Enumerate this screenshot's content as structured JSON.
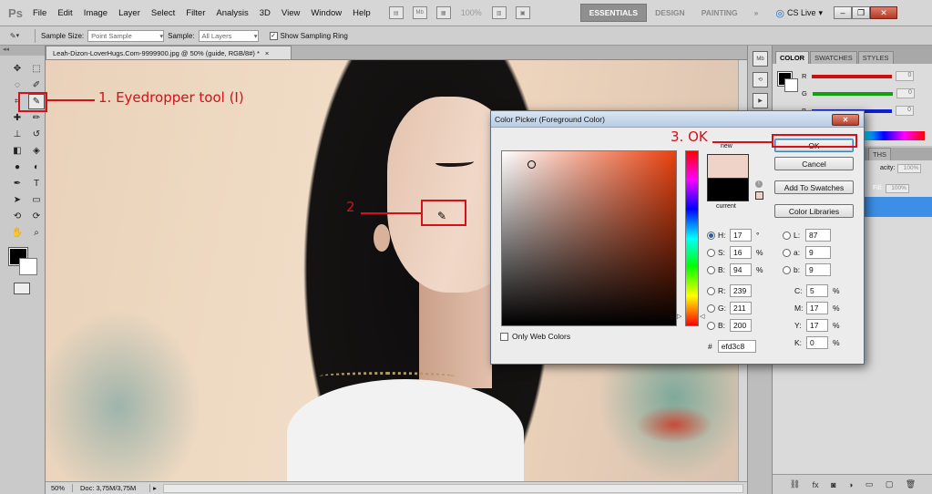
{
  "app": {
    "logo": "Ps",
    "menu": [
      "File",
      "Edit",
      "Image",
      "Layer",
      "Select",
      "Filter",
      "Analysis",
      "3D",
      "View",
      "Window",
      "Help"
    ],
    "mb_icon": "Mb",
    "zoom_dropdown": "100%",
    "workspaces": [
      "ESSENTIALS",
      "DESIGN",
      "PAINTING"
    ],
    "workspace_more": "»",
    "cs_live": "CS Live"
  },
  "options_bar": {
    "sample_size_label": "Sample Size:",
    "sample_size_value": "Point Sample",
    "sample_label": "Sample:",
    "sample_value": "All Layers",
    "show_ring_label": "Show Sampling Ring",
    "show_ring_checked": true
  },
  "document": {
    "tab_title": "Leah-Dizon-LoverHugs.Com-9999900.jpg @ 50% (guide, RGB/8#) *",
    "tab_close": "×",
    "zoom": "50%",
    "doc_size": "Doc: 3,75M/3,75M"
  },
  "panels": {
    "color_tabs": [
      "COLOR",
      "SWATCHES",
      "STYLES"
    ],
    "channels": [
      {
        "label": "R",
        "value": "0",
        "color": "#cc1010"
      },
      {
        "label": "G",
        "value": "0",
        "color": "#10a010"
      },
      {
        "label": "B",
        "value": "0",
        "color": "#1020cc"
      }
    ],
    "layers_tab": "THS",
    "opacity_label": "acity:",
    "opacity_value": "100%",
    "fill_label": "Fill:",
    "fill_value": "100%"
  },
  "color_picker": {
    "title": "Color Picker (Foreground Color)",
    "label_new": "new",
    "label_current": "current",
    "new_color": "#efd3c8",
    "current_color": "#000000",
    "buttons": {
      "ok": "OK",
      "cancel": "Cancel",
      "add_swatches": "Add To Swatches",
      "color_libraries": "Color Libraries"
    },
    "hsb": [
      {
        "label": "H:",
        "value": "17",
        "unit": "°",
        "selected": true
      },
      {
        "label": "S:",
        "value": "16",
        "unit": "%",
        "selected": false
      },
      {
        "label": "B:",
        "value": "94",
        "unit": "%",
        "selected": false
      }
    ],
    "rgb": [
      {
        "label": "R:",
        "value": "239"
      },
      {
        "label": "G:",
        "value": "211"
      },
      {
        "label": "B:",
        "value": "200"
      }
    ],
    "lab": [
      {
        "label": "L:",
        "value": "87"
      },
      {
        "label": "a:",
        "value": "9"
      },
      {
        "label": "b:",
        "value": "9"
      }
    ],
    "cmyk": [
      {
        "label": "C:",
        "value": "5",
        "unit": "%"
      },
      {
        "label": "M:",
        "value": "17",
        "unit": "%"
      },
      {
        "label": "Y:",
        "value": "17",
        "unit": "%"
      },
      {
        "label": "K:",
        "value": "0",
        "unit": "%"
      }
    ],
    "hex_label": "#",
    "hex_value": "efd3c8",
    "only_web_label": "Only Web Colors"
  },
  "annotations": {
    "step1": "1. Eyedropper tool (I)",
    "step2": "2",
    "step3": "3. OK",
    "color": "#d6101a"
  }
}
